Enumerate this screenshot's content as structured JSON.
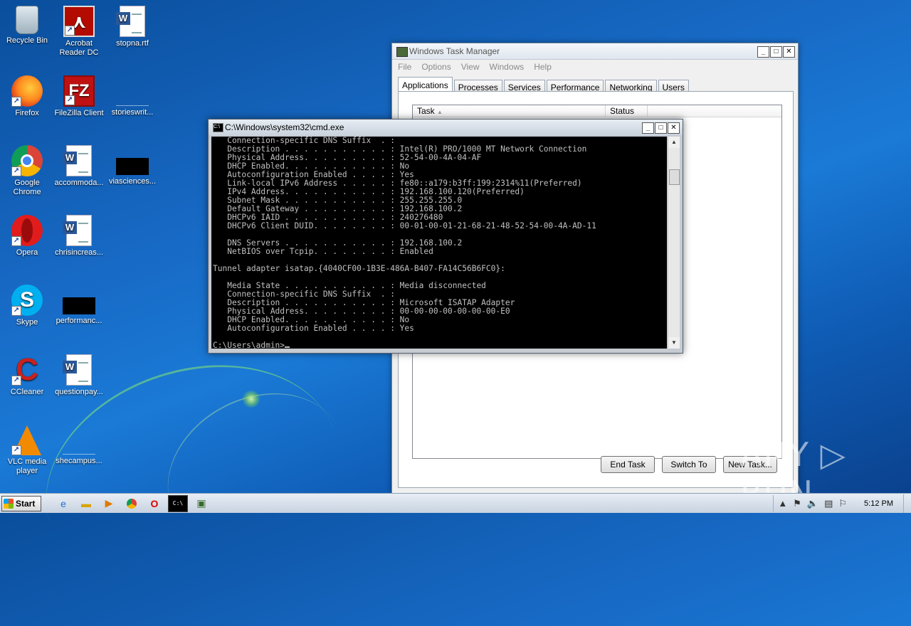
{
  "desktop": {
    "icons": [
      {
        "label": "Recycle Bin",
        "icon": "recycle-bin-icon"
      },
      {
        "label": "Acrobat Reader DC",
        "icon": "acrobat-reader-icon"
      },
      {
        "label": "stopna.rtf",
        "icon": "word-document-icon"
      },
      {
        "label": "Firefox",
        "icon": "firefox-icon"
      },
      {
        "label": "FileZilla Client",
        "icon": "filezilla-icon"
      },
      {
        "label": "storieswrit...",
        "icon": "blank-file-icon"
      },
      {
        "label": "Google Chrome",
        "icon": "chrome-icon"
      },
      {
        "label": "accommoda...",
        "icon": "word-document-icon"
      },
      {
        "label": "viasciences...",
        "icon": "black-file-icon"
      },
      {
        "label": "Opera",
        "icon": "opera-icon"
      },
      {
        "label": "chrisincreas...",
        "icon": "word-document-icon"
      },
      {
        "label": "Skype",
        "icon": "skype-icon"
      },
      {
        "label": "performanc...",
        "icon": "black-file-icon"
      },
      {
        "label": "CCleaner",
        "icon": "ccleaner-icon"
      },
      {
        "label": "questionpay...",
        "icon": "word-document-icon"
      },
      {
        "label": "VLC media player",
        "icon": "vlc-icon"
      },
      {
        "label": "shecampus...",
        "icon": "blank-file-icon"
      }
    ]
  },
  "task_manager": {
    "title": "Windows Task Manager",
    "menu": [
      "File",
      "Options",
      "View",
      "Windows",
      "Help"
    ],
    "tabs": [
      "Applications",
      "Processes",
      "Services",
      "Performance",
      "Networking",
      "Users"
    ],
    "active_tab": "Applications",
    "columns": [
      "Task",
      "Status"
    ],
    "buttons": {
      "end_task": "End Task",
      "switch_to": "Switch To",
      "new_task": "New Task..."
    }
  },
  "cmd": {
    "title": "C:\\Windows\\system32\\cmd.exe",
    "lines": [
      "   Connection-specific DNS Suffix  . :",
      "   Description . . . . . . . . . . . : Intel(R) PRO/1000 MT Network Connection",
      "   Physical Address. . . . . . . . . : 52-54-00-4A-04-AF",
      "   DHCP Enabled. . . . . . . . . . . : No",
      "   Autoconfiguration Enabled . . . . : Yes",
      "   Link-local IPv6 Address . . . . . : fe80::a179:b3ff:199:2314%11(Preferred)",
      "   IPv4 Address. . . . . . . . . . . : 192.168.100.120(Preferred)",
      "   Subnet Mask . . . . . . . . . . . : 255.255.255.0",
      "   Default Gateway . . . . . . . . . : 192.168.100.2",
      "   DHCPv6 IAID . . . . . . . . . . . : 240276480",
      "   DHCPv6 Client DUID. . . . . . . . : 00-01-00-01-21-68-21-48-52-54-00-4A-AD-11",
      "",
      "   DNS Servers . . . . . . . . . . . : 192.168.100.2",
      "   NetBIOS over Tcpip. . . . . . . . : Enabled",
      "",
      "Tunnel adapter isatap.{4040CF00-1B3E-486A-B407-FA14C56B6FC0}:",
      "",
      "   Media State . . . . . . . . . . . : Media disconnected",
      "   Connection-specific DNS Suffix  . :",
      "   Description . . . . . . . . . . . : Microsoft ISATAP Adapter",
      "   Physical Address. . . . . . . . . : 00-00-00-00-00-00-00-E0",
      "   DHCP Enabled. . . . . . . . . . . : No",
      "   Autoconfiguration Enabled . . . . : Yes",
      ""
    ],
    "prompt": "C:\\Users\\admin>"
  },
  "watermark": "ANY ▷ RUN",
  "taskbar": {
    "start_label": "Start",
    "clock": "5:12 PM"
  }
}
